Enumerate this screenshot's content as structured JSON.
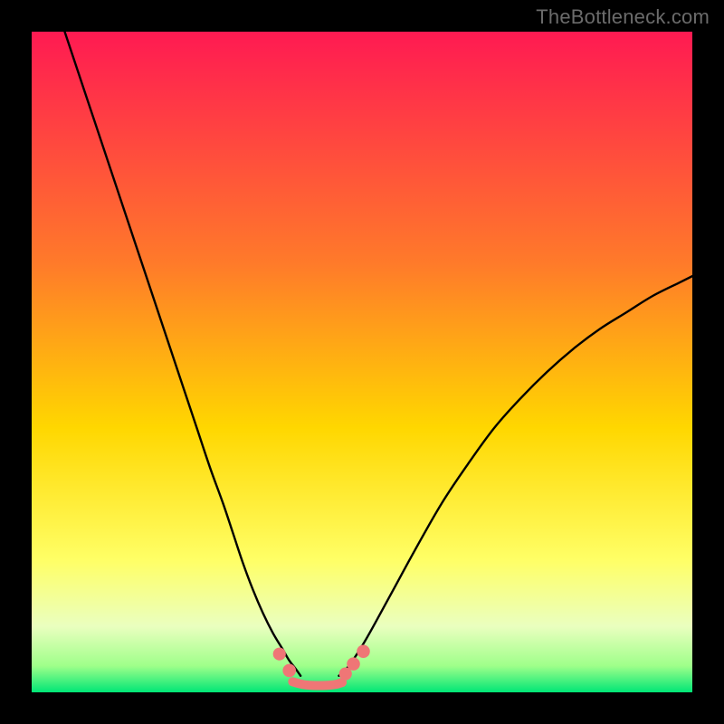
{
  "watermark": "TheBottleneck.com",
  "chart_data": {
    "type": "line",
    "title": "",
    "xlabel": "",
    "ylabel": "",
    "xlim": [
      0,
      100
    ],
    "ylim": [
      0,
      100
    ],
    "grid": false,
    "legend": false,
    "background_gradient": {
      "stops": [
        {
          "offset": 0.0,
          "color": "#ff1a52"
        },
        {
          "offset": 0.35,
          "color": "#ff7a2a"
        },
        {
          "offset": 0.6,
          "color": "#ffd700"
        },
        {
          "offset": 0.8,
          "color": "#ffff66"
        },
        {
          "offset": 0.9,
          "color": "#eaffbf"
        },
        {
          "offset": 0.96,
          "color": "#9fff8a"
        },
        {
          "offset": 1.0,
          "color": "#00e676"
        }
      ]
    },
    "series": [
      {
        "name": "left-curve",
        "color": "#000000",
        "x": [
          5,
          8,
          11,
          14,
          17,
          20,
          23,
          25,
          27,
          29,
          30.5,
          32,
          33.5,
          35,
          36.5,
          38,
          39,
          40,
          40.7
        ],
        "y": [
          100,
          91,
          82,
          73,
          64,
          55,
          46,
          40,
          34,
          28.5,
          24,
          19.5,
          15.5,
          12,
          9,
          6.5,
          4.8,
          3.5,
          2.5
        ]
      },
      {
        "name": "right-curve",
        "color": "#000000",
        "x": [
          46.5,
          48,
          50,
          52,
          55,
          58,
          62,
          66,
          70,
          74,
          78,
          82,
          86,
          90,
          94,
          98,
          100
        ],
        "y": [
          2.5,
          4,
          7,
          10.5,
          16,
          21.5,
          28.5,
          34.5,
          40,
          44.5,
          48.5,
          52,
          55,
          57.5,
          60,
          62,
          63
        ]
      },
      {
        "name": "bottom-pink",
        "color": "#ef7676",
        "type": "line",
        "stroke_width": 10,
        "x": [
          39.5,
          41,
          42.5,
          44.5,
          46,
          47
        ],
        "y": [
          1.6,
          1.2,
          1.05,
          1.05,
          1.2,
          1.5
        ]
      }
    ],
    "markers": [
      {
        "name": "pink-dot",
        "x": 37.5,
        "y": 5.8,
        "r": 4.0,
        "color": "#ef7676"
      },
      {
        "name": "pink-dot",
        "x": 39.0,
        "y": 3.3,
        "r": 4.2,
        "color": "#ef7676"
      },
      {
        "name": "pink-dot",
        "x": 47.5,
        "y": 2.8,
        "r": 4.0,
        "color": "#ef7676"
      },
      {
        "name": "pink-dot",
        "x": 48.7,
        "y": 4.3,
        "r": 4.2,
        "color": "#ef7676"
      },
      {
        "name": "pink-dot",
        "x": 50.2,
        "y": 6.2,
        "r": 4.2,
        "color": "#ef7676"
      }
    ]
  }
}
